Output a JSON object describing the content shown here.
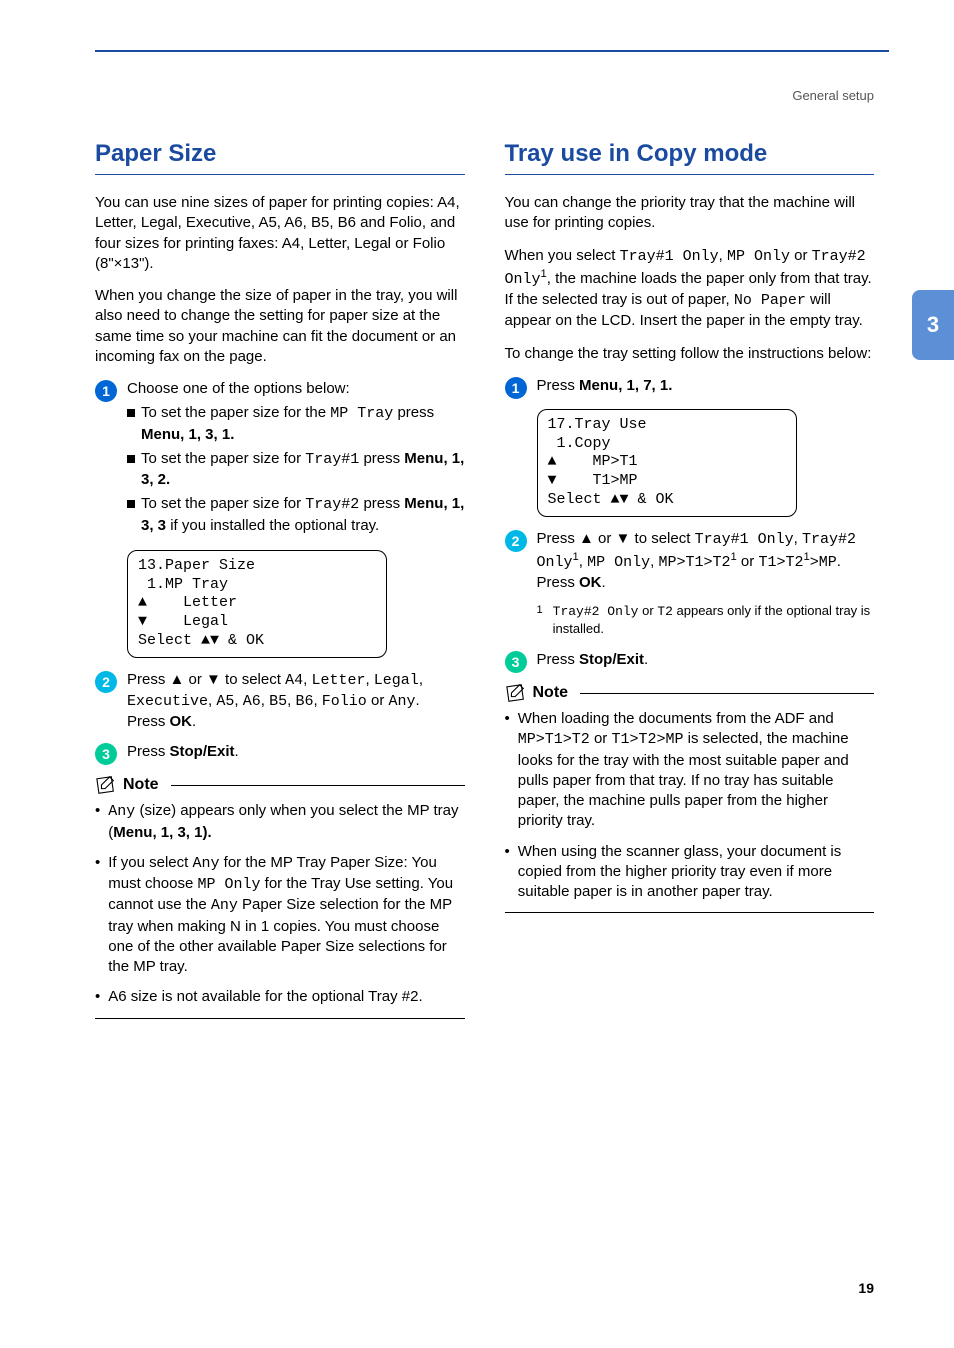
{
  "header": {
    "breadcrumb": "General setup"
  },
  "side_tab": "3",
  "page_number": "19",
  "left": {
    "title": "Paper Size",
    "para1": "You can use nine sizes of paper for printing copies: A4, Letter, Legal, Executive, A5, A6, B5, B6 and Folio, and four sizes for printing faxes: A4, Letter, Legal or Folio (8\"×13\").",
    "para2": "When you change the size of paper in the tray, you will also need to change the setting for paper size at the same time so your machine can fit the document or an incoming fax on the page.",
    "step1_lead": "Choose one of the options below:",
    "step1_items": {
      "a_pre": "To set the paper size for the ",
      "a_code": "MP Tray",
      "a_post": " press ",
      "a_menu": "Menu",
      "a_seq": ", 1, 3, 1.",
      "b_pre": "To set the paper size for ",
      "b_code": "Tray#1",
      "b_post": " press ",
      "b_menu": "Menu",
      "b_seq": ", 1, 3, 2.",
      "c_pre": "To set the paper size for ",
      "c_code": "Tray#2",
      "c_post": " press ",
      "c_menu": "Menu",
      "c_seq": ", 1, 3, 3",
      "c_tail": " if you installed the optional tray."
    },
    "lcd": "13.Paper Size\n 1.MP Tray\n▲    Letter\n▼    Legal\nSelect ▲▼ & OK",
    "step2_pre": "Press ▲ or ▼ to select ",
    "step2_codes": "A4, Letter, Legal, Executive, A5, A6, B5, B6, Folio",
    "step2_or": " or ",
    "step2_any": "Any",
    "step2_dot": ".",
    "step2_ok_pre": "Press ",
    "step2_ok": "OK",
    "step2_ok_post": ".",
    "step3_pre": "Press ",
    "step3_btn": "Stop/Exit",
    "step3_post": ".",
    "note_title": "Note",
    "note_items": {
      "n1_code1": "Any",
      "n1_text": " (size) appears only when you select the MP tray (",
      "n1_menu": "Menu",
      "n1_seq": ", 1, 3, 1).",
      "n2_a": "If you select ",
      "n2_code1": "Any",
      "n2_b": " for the MP Tray Paper Size: You must choose ",
      "n2_code2": "MP Only",
      "n2_c": " for the Tray Use setting. You cannot use the ",
      "n2_code3": "Any",
      "n2_d": " Paper Size selection for the MP tray when making N in 1 copies. You must choose one of the other available Paper Size selections for the MP tray.",
      "n3": "A6 size is not available for the optional Tray #2."
    }
  },
  "right": {
    "title": "Tray use in Copy mode",
    "para1": "You can change the priority tray that the machine will use for printing copies.",
    "para2_a": "When you select ",
    "para2_code1": "Tray#1 Only",
    "para2_b": ", ",
    "para2_code2": "MP Only",
    "para2_c": " or ",
    "para2_code3": "Tray#2 Only",
    "para2_sup": "1",
    "para2_d": ", the machine loads the paper only from that tray. If the selected tray is out of paper, ",
    "para2_code4": "No Paper",
    "para2_e": " will appear on the LCD. Insert the paper in the empty tray.",
    "para3": "To change the tray setting follow the instructions below:",
    "step1_pre": "Press ",
    "step1_menu": "Menu",
    "step1_seq": ", 1, 7, 1.",
    "lcd": "17.Tray Use\n 1.Copy\n▲    MP>T1\n▼    T1>MP\nSelect ▲▼ & OK",
    "step2_a": "Press ▲ or ▼ to select ",
    "step2_code1": "Tray#1 Only",
    "step2_b": ", ",
    "step2_code2": "Tray#2 Only",
    "step2_sup1": "1",
    "step2_c": ", ",
    "step2_code3": "MP Only",
    "step2_d": ", ",
    "step2_code4": "MP>T1>T2",
    "step2_sup2": "1",
    "step2_e": " or ",
    "step2_code5": "T1>T2",
    "step2_sup3": "1",
    "step2_f": ">",
    "step2_code6": "MP",
    "step2_g": ". Press ",
    "step2_ok": "OK",
    "step2_h": ".",
    "footnote_num": "1",
    "footnote_a": "Tray#2 Only",
    "footnote_b": " or ",
    "footnote_c": "T2",
    "footnote_d": " appears only if the optional tray is installed.",
    "step3_pre": "Press ",
    "step3_btn": "Stop/Exit",
    "step3_post": ".",
    "note_title": "Note",
    "note_items": {
      "n1_a": "When loading the documents from the ADF and ",
      "n1_code1": "MP>T1>T2",
      "n1_b": " or ",
      "n1_code2": "T1>T2>MP",
      "n1_c": " is selected, the machine looks for the tray with the most suitable paper and pulls paper from that tray. If no tray has suitable paper, the machine pulls paper from the higher priority tray.",
      "n2": "When using the scanner glass, your document is copied from the higher priority tray even if more suitable paper is in another paper tray."
    }
  }
}
